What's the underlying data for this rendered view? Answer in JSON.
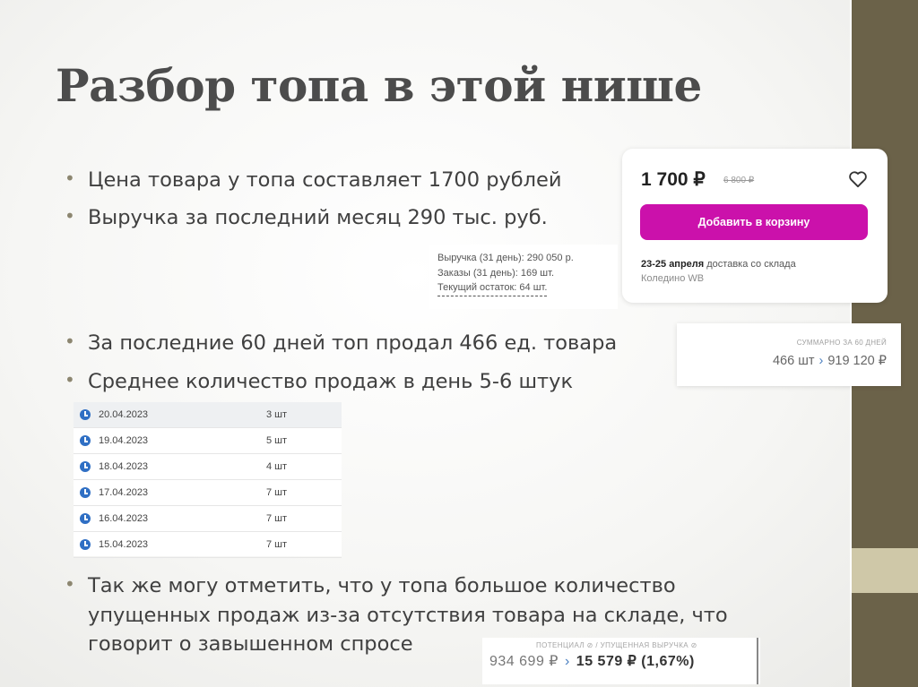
{
  "slide": {
    "title": "Разбор топа в этой нише",
    "bullets": [
      "Цена товара у топа составляет 1700 рублей",
      "Выручка за последний месяц 290 тыс. руб.",
      "За последние 60 дней топ продал 466 ед. товара",
      "Среднее количество продаж в день 5-6 штук",
      "Так же могу отметить, что у топа большое количество упущенных продаж из-за отсутствия товара на складе, что говорит о завышенном спросе"
    ],
    "bullet_glyph": "•"
  },
  "product_card": {
    "price": "1 700 ₽",
    "old_price": "6 800 ₽",
    "favorite_icon": "heart-icon",
    "cart_button": "Добавить в корзину",
    "delivery_dates": "23-25 апреля",
    "delivery_text": "доставка со склада",
    "warehouse": "Коледино WB",
    "accent_color": "#cb11ab"
  },
  "revenue_stats": {
    "revenue": "Выручка (31 день): 290 050 р.",
    "orders": "Заказы (31 день): 169 шт.",
    "stock": "Текущий остаток: 64 шт."
  },
  "summary_60d": {
    "label": "СУММАРНО ЗА 60 ДНЕЙ",
    "units": "466 шт",
    "amount": "919 120 ₽"
  },
  "daily_sales": [
    {
      "date": "20.04.2023",
      "qty": "3 шт"
    },
    {
      "date": "19.04.2023",
      "qty": "5 шт"
    },
    {
      "date": "18.04.2023",
      "qty": "4 шт"
    },
    {
      "date": "17.04.2023",
      "qty": "7 шт"
    },
    {
      "date": "16.04.2023",
      "qty": "7 шт"
    },
    {
      "date": "15.04.2023",
      "qty": "7 шт"
    }
  ],
  "lost_revenue": {
    "label": "ПОТЕНЦИАЛ  ⊘ / УПУЩЕННАЯ ВЫРУЧКА  ⊘",
    "potential": "934 699 ₽",
    "lost": "15 579 ₽ (1,67%)"
  },
  "colors": {
    "sidebar": "#6b6249",
    "sidebar_accent": "#cfc8a8",
    "link_blue": "#2f6fc4"
  }
}
